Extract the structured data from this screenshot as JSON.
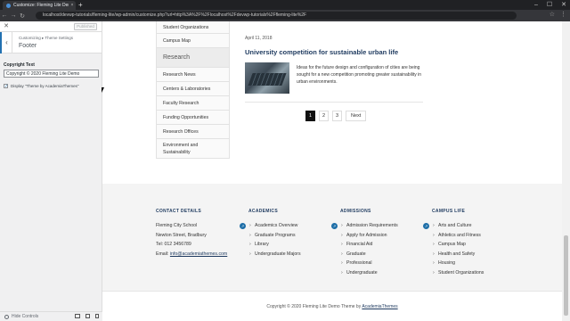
{
  "browser": {
    "tab_title": "Customize: Fleming Lite Demo",
    "tab_close": "×",
    "new_tab": "+",
    "url": "localhost/devwp-tutorials/fleming-lite/wp-admin/customize.php?url=http%3A%2F%2Flocalhost%2Fdevwp-tutorials%2Ffleming-lite%2F",
    "win_min": "–",
    "win_max": "☐",
    "win_close": "✕",
    "nav_back": "←",
    "nav_forward": "→",
    "nav_reload": "↻",
    "nav_home": "⌂",
    "star": "☆",
    "menu": "⋮"
  },
  "customizer": {
    "close": "✕",
    "publish_label": "Published",
    "back": "‹",
    "breadcrumb": "Customizing ▸ Theme Settings",
    "section_title": "Footer",
    "copyright_label": "Copyright Text",
    "copyright_value": "Copyright © 2020 Fleming Lite Demo",
    "check_mark": "✓",
    "display_theme_label": "Display \"Theme by AcademiaThemes\"",
    "hide_controls": "Hide Controls"
  },
  "sidenav": {
    "items": [
      "Student Organizations",
      "Campus Map",
      "Research",
      "Research News",
      "Centers & Laboratories",
      "Faculty Research",
      "Funding Opportunities",
      "Research Offices",
      "Environment and Sustainability"
    ]
  },
  "news": {
    "date": "April 11, 2018",
    "title": "University competition for sustainable urban life",
    "excerpt": "Ideas for the future design and configuration of cities are being sought for a new competition promoting greater sustainability in urban environments."
  },
  "pagination": {
    "pages": [
      "1",
      "2",
      "3"
    ],
    "next": "Next",
    "current": "1"
  },
  "footer": {
    "contact": {
      "heading": "CONTACT DETAILS",
      "name": "Fleming City School",
      "address": "Newton Street, Bradbury",
      "tel": "Tel: 012 3456789",
      "email_label": "Email:",
      "email": "info@academiathemes.com"
    },
    "academics": {
      "heading": "ACADEMICS",
      "items": [
        "Academics Overview",
        "Graduate Programs",
        "Library",
        "Undergraduate Majors"
      ]
    },
    "admissions": {
      "heading": "ADMISSIONS",
      "items": [
        "Admission Requirements",
        "Apply for Admission",
        "Financial Aid",
        "Graduate",
        "Professional",
        "Undergraduate"
      ]
    },
    "campus_life": {
      "heading": "CAMPUS LIFE",
      "items": [
        "Arts and Culture",
        "Athletics and Fitness",
        "Campus Map",
        "Health and Safety",
        "Housing",
        "Student Organizations"
      ]
    },
    "badge_icon": "↗"
  },
  "copyright_bar": {
    "text": "Copyright © 2020 Fleming Lite Demo Theme by",
    "link": "AcademiaThemes"
  },
  "colors": {
    "accent": "#2271b1",
    "navy": "#1e3a5f",
    "badge": "#1f6fa8"
  }
}
